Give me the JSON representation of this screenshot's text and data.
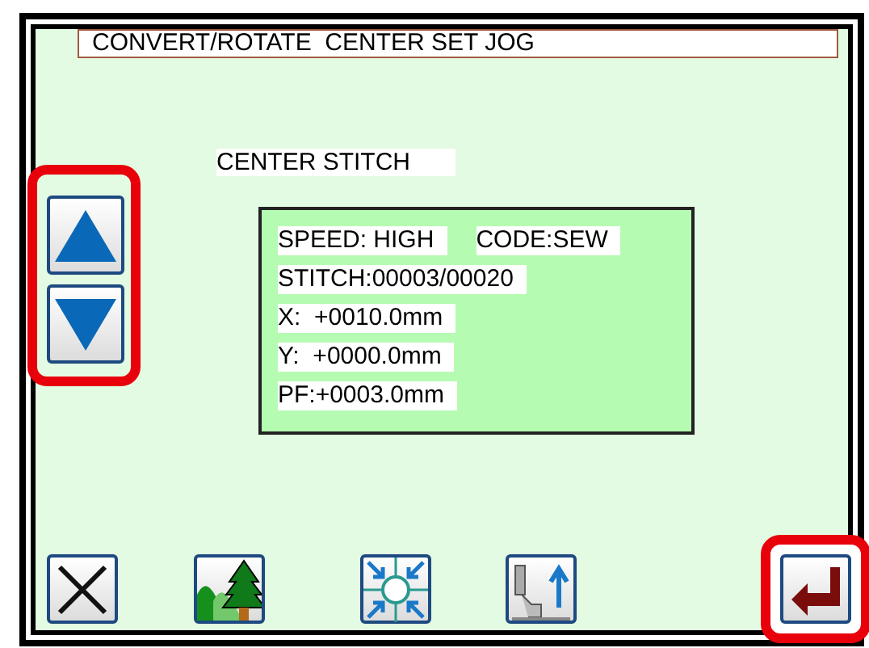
{
  "title": "CONVERT/ROTATE  CENTER SET JOG",
  "label": "CENTER STITCH",
  "info_rows": [
    [
      "SPEED: HIGH",
      "CODE:SEW"
    ],
    [
      "STITCH:00003/00020"
    ],
    [
      "X:  +0010.0mm"
    ],
    [
      "Y:  +0000.0mm"
    ],
    [
      "PF:+0003.0mm"
    ]
  ],
  "jog": {
    "highlighted": true,
    "buttons": [
      {
        "kind": "up"
      },
      {
        "kind": "down"
      }
    ]
  },
  "toolbar": [
    {
      "kind": "cancel",
      "highlighted": false
    },
    {
      "kind": "scenery",
      "highlighted": false
    },
    {
      "kind": "center",
      "highlighted": false
    },
    {
      "kind": "presser",
      "highlighted": false
    },
    {
      "kind": "enter",
      "highlighted": true
    }
  ]
}
